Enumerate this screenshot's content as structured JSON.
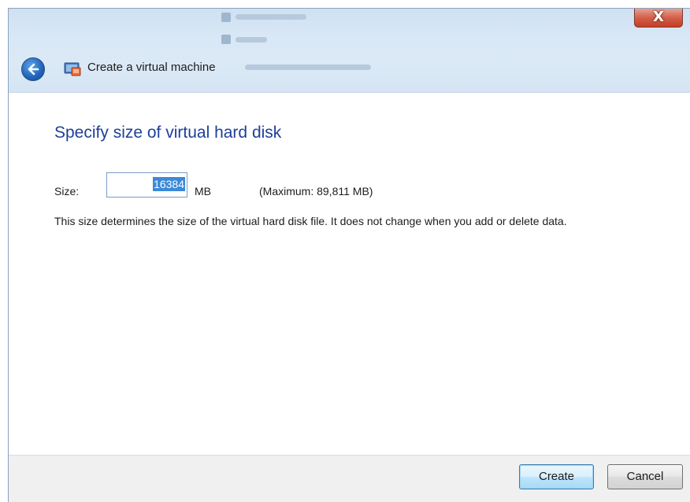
{
  "window": {
    "title": "Create a virtual machine",
    "close_glyph": "X",
    "colors": {
      "heading": "#1e3f9a",
      "selection": "#3b89d8",
      "titlebar": "#d9e8f6"
    }
  },
  "page": {
    "heading": "Specify size of virtual hard disk",
    "size_label": "Size:",
    "size_value": "16384",
    "size_unit": "MB",
    "maximum": "(Maximum: 89,811 MB)",
    "description": "This size determines the size of the virtual hard disk file. It does not change when you add or delete data."
  },
  "buttons": {
    "create": "Create",
    "cancel": "Cancel"
  },
  "icons": {
    "back": "back-arrow-icon",
    "app": "virtual-machine-icon",
    "close": "close-icon"
  }
}
